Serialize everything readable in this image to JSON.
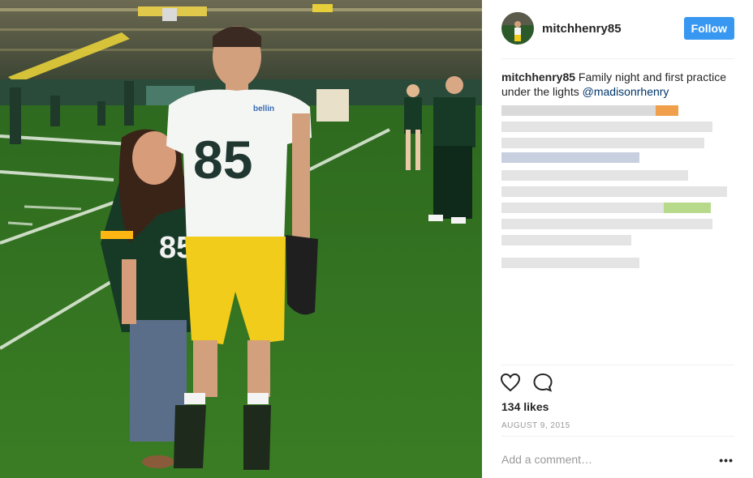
{
  "post": {
    "username": "mitchhenry85",
    "follow_label": "Follow",
    "caption_user": "mitchhenry85",
    "caption_text": " Family night and first practice under the lights ",
    "caption_mention": "@madisonrhenry",
    "likes": "134 likes",
    "date": "AUGUST 9, 2015",
    "comment_placeholder": "Add a comment…",
    "more_label": "•••"
  },
  "photo": {
    "jersey_number": "85",
    "sponsor": "bellin health"
  },
  "colors": {
    "follow_button": "#3897f0",
    "mention": "#003569",
    "packers_green": "#203731",
    "packers_gold": "#ffb612"
  },
  "icons": [
    "heart-icon",
    "comment-icon",
    "more-options-icon"
  ]
}
